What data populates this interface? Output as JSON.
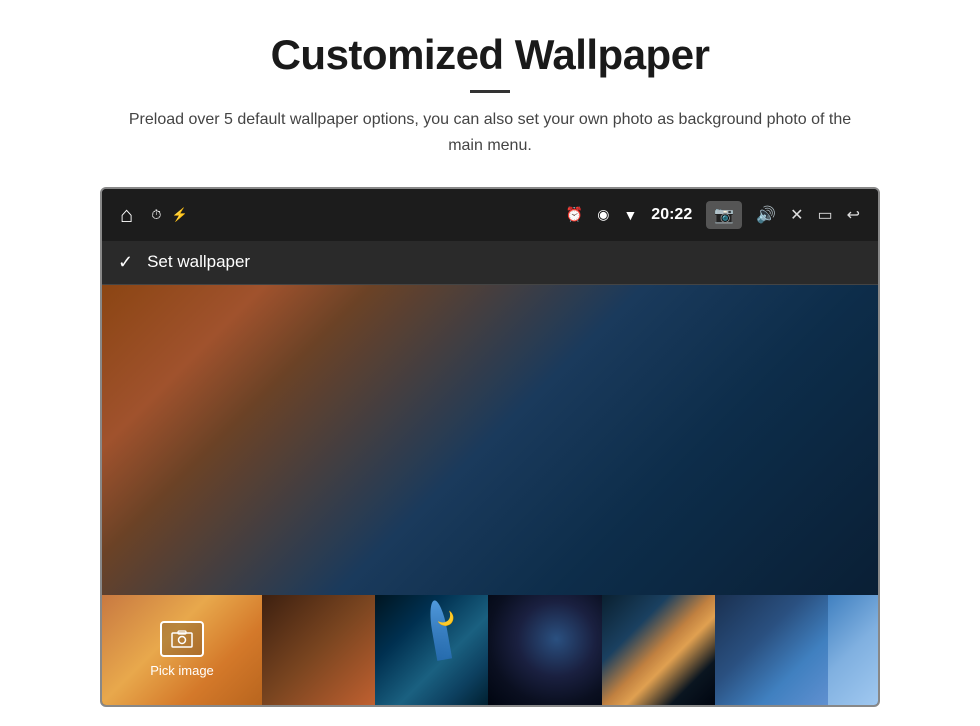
{
  "page": {
    "title": "Customized Wallpaper",
    "subtitle": "Preload over 5 default wallpaper options, you can also set your own photo as background photo of the main menu."
  },
  "statusBar": {
    "time": "20:22",
    "leftIcons": [
      "🏠",
      "⏰",
      "⚡"
    ],
    "rightIcons": [
      "⏰",
      "📍",
      "▼",
      "📷",
      "🔊",
      "✕",
      "▭",
      "↩"
    ]
  },
  "actionBar": {
    "checkLabel": "✓",
    "actionText": "Set wallpaper"
  },
  "thumbnails": {
    "pickImageLabel": "Pick image",
    "items": [
      {
        "id": "pick",
        "label": "Pick image"
      },
      {
        "id": "thumb2",
        "label": ""
      },
      {
        "id": "thumb3",
        "label": ""
      },
      {
        "id": "thumb4",
        "label": ""
      },
      {
        "id": "thumb5",
        "label": ""
      },
      {
        "id": "thumb6",
        "label": ""
      },
      {
        "id": "thumb7",
        "label": ""
      }
    ]
  }
}
